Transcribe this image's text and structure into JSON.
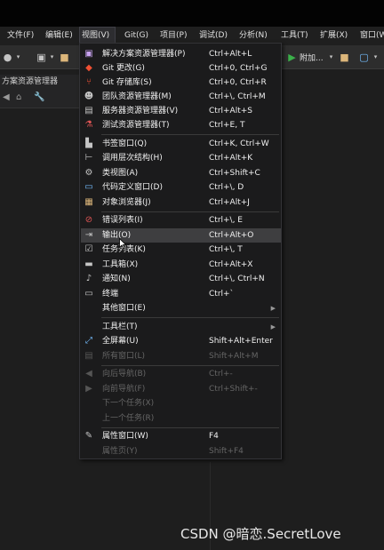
{
  "menubar": {
    "items": [
      {
        "label": "文件(F)"
      },
      {
        "label": "编辑(E)"
      },
      {
        "label": "视图(V)"
      },
      {
        "label": "Git(G)"
      },
      {
        "label": "项目(P)"
      },
      {
        "label": "调试(D)"
      },
      {
        "label": "分析(N)"
      },
      {
        "label": "工具(T)"
      },
      {
        "label": "扩展(X)"
      },
      {
        "label": "窗口(W"
      }
    ]
  },
  "toolbar": {
    "attach_label": "附加..."
  },
  "left_panel": {
    "title": "方案资源管理器"
  },
  "view_menu": {
    "items": [
      {
        "label": "解决方案资源管理器(P)",
        "shortcut": "Ctrl+Alt+L",
        "icon": "solution-explorer-icon"
      },
      {
        "label": "Git 更改(G)",
        "shortcut": "Ctrl+0, Ctrl+G",
        "icon": "git-changes-icon"
      },
      {
        "label": "Git 存储库(S)",
        "shortcut": "Ctrl+0, Ctrl+R",
        "icon": "git-repository-icon"
      },
      {
        "label": "团队资源管理器(M)",
        "shortcut": "Ctrl+\\, Ctrl+M",
        "icon": "team-explorer-icon"
      },
      {
        "label": "服务器资源管理器(V)",
        "shortcut": "Ctrl+Alt+S",
        "icon": "server-explorer-icon"
      },
      {
        "label": "测试资源管理器(T)",
        "shortcut": "Ctrl+E, T",
        "icon": "test-explorer-icon"
      },
      {
        "label": "书签窗口(Q)",
        "shortcut": "Ctrl+K, Ctrl+W",
        "icon": "bookmark-icon"
      },
      {
        "label": "调用层次结构(H)",
        "shortcut": "Ctrl+Alt+K",
        "icon": "call-hierarchy-icon"
      },
      {
        "label": "类视图(A)",
        "shortcut": "Ctrl+Shift+C",
        "icon": "class-view-icon"
      },
      {
        "label": "代码定义窗口(D)",
        "shortcut": "Ctrl+\\, D",
        "icon": "code-definition-icon"
      },
      {
        "label": "对象浏览器(J)",
        "shortcut": "Ctrl+Alt+J",
        "icon": "object-browser-icon"
      },
      {
        "label": "错误列表(I)",
        "shortcut": "Ctrl+\\, E",
        "icon": "error-list-icon"
      },
      {
        "label": "输出(O)",
        "shortcut": "Ctrl+Alt+O",
        "icon": "output-icon"
      },
      {
        "label": "任务列表(K)",
        "shortcut": "Ctrl+\\, T",
        "icon": "task-list-icon"
      },
      {
        "label": "工具箱(X)",
        "shortcut": "Ctrl+Alt+X",
        "icon": "toolbox-icon"
      },
      {
        "label": "通知(N)",
        "shortcut": "Ctrl+\\, Ctrl+N",
        "icon": "notification-bell-icon"
      },
      {
        "label": "终端",
        "shortcut": "Ctrl+`",
        "icon": "terminal-icon"
      },
      {
        "label": "其他窗口(E)",
        "shortcut": "",
        "icon": ""
      },
      {
        "label": "工具栏(T)",
        "shortcut": "",
        "icon": ""
      },
      {
        "label": "全屏幕(U)",
        "shortcut": "Shift+Alt+Enter",
        "icon": "fullscreen-icon"
      },
      {
        "label": "所有窗口(L)",
        "shortcut": "Shift+Alt+M",
        "icon": "all-windows-icon"
      },
      {
        "label": "向后导航(B)",
        "shortcut": "Ctrl+-",
        "icon": "navigate-back-icon"
      },
      {
        "label": "向前导航(F)",
        "shortcut": "Ctrl+Shift+-",
        "icon": "navigate-forward-icon"
      },
      {
        "label": "下一个任务(X)",
        "shortcut": "",
        "icon": ""
      },
      {
        "label": "上一个任务(R)",
        "shortcut": "",
        "icon": ""
      },
      {
        "label": "属性窗口(W)",
        "shortcut": "F4",
        "icon": "wrench-icon"
      },
      {
        "label": "属性页(Y)",
        "shortcut": "Shift+F4",
        "icon": ""
      }
    ]
  },
  "watermark": "CSDN @暗恋.SecretLove",
  "colors": {
    "background": "#1e1e1e",
    "menu_bg": "#1b1b1c",
    "highlight": "#3e3e40",
    "disabled_text": "#656565",
    "play_green": "#3bb04a"
  }
}
